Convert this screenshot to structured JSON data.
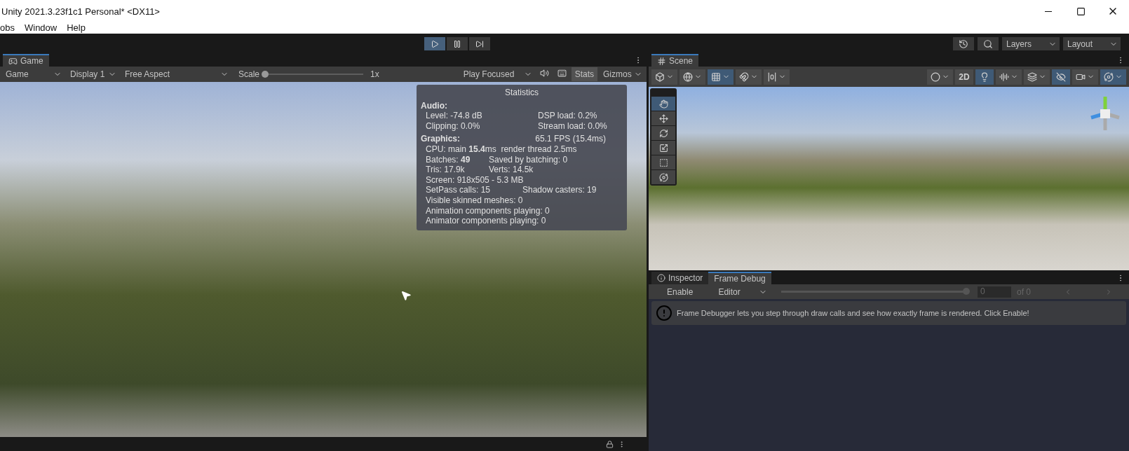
{
  "window": {
    "title": "Unity 2021.3.23f1c1 Personal* <DX11>"
  },
  "menu": [
    "obs",
    "Window",
    "Help"
  ],
  "play_controls": [
    {
      "kind": "play",
      "selected": true
    },
    {
      "kind": "pause",
      "selected": false
    },
    {
      "kind": "step",
      "selected": false
    }
  ],
  "main_toolbar": {
    "layers": "Layers",
    "layout": "Layout"
  },
  "game": {
    "tab": "Game",
    "toolbar": {
      "view": "Game",
      "display": "Display 1",
      "aspect": "Free Aspect",
      "scale_label": "Scale",
      "scale": {
        "level": 0
      },
      "scale_value": "1x",
      "play_mode": "Play Focused",
      "stats": {
        "label": "Stats",
        "selected": true
      },
      "gizmos": "Gizmos"
    },
    "statistics": {
      "title": "Statistics",
      "sections": [
        {
          "heading": "Audio:",
          "rows": [
            {
              "kind": "wide",
              "cells": [
                "Level: -74.8 dB",
                "DSP load: 0.2%"
              ]
            },
            {
              "kind": "wide",
              "cells": [
                "Clipping: 0.0%",
                "Stream load: 0.0%"
              ]
            }
          ]
        },
        {
          "heading": "Graphics:",
          "aside": "65.1 FPS (15.4ms)",
          "rows": [
            {
              "kind": "single",
              "cells": [
                "CPU: main **15.4**ms  render thread 2.5ms"
              ]
            },
            {
              "kind": "narrow",
              "cells": [
                "Batches: **49**",
                "Saved by batching: 0"
              ]
            },
            {
              "kind": "narrow",
              "cells": [
                "Tris: 17.9k",
                "Verts: 14.5k"
              ]
            },
            {
              "kind": "single",
              "cells": [
                "Screen: 918x505 - 5.3 MB"
              ]
            },
            {
              "kind": "medium",
              "cells": [
                "SetPass calls: 15",
                "Shadow casters: 19"
              ]
            },
            {
              "kind": "single",
              "cells": [
                "Visible skinned meshes: 0"
              ]
            },
            {
              "kind": "single",
              "cells": [
                "Animation components playing: 0"
              ]
            },
            {
              "kind": "single",
              "cells": [
                "Animator components playing: 0"
              ]
            }
          ]
        }
      ]
    }
  },
  "scene": {
    "tab": "Scene",
    "toolbar": [
      {
        "kind": "icon",
        "selected": false
      },
      {
        "kind": "icon",
        "selected": false
      },
      {
        "kind": "icon",
        "selected": true
      },
      {
        "kind": "icon",
        "selected": false
      },
      {
        "kind": "icon",
        "selected": false
      },
      {
        "kind": "icon",
        "selected": false
      },
      {
        "kind": "text",
        "label": "2D",
        "selected": false
      },
      {
        "kind": "icon",
        "selected": true
      },
      {
        "kind": "icon",
        "selected": false
      },
      {
        "kind": "icon",
        "selected": false
      },
      {
        "kind": "icon",
        "selected": true
      },
      {
        "kind": "icon",
        "selected": false
      },
      {
        "kind": "icon",
        "selected": true
      }
    ],
    "tools": [
      {
        "selected": true
      },
      {
        "selected": false
      },
      {
        "selected": false
      },
      {
        "selected": false
      },
      {
        "selected": false
      },
      {
        "selected": false
      }
    ]
  },
  "inspector": {
    "tabs": [
      {
        "label": "Inspector",
        "selected": false
      },
      {
        "label": "Frame Debug",
        "selected": true
      }
    ],
    "enable": "Enable",
    "mode": "Editor",
    "event": {
      "level": 1
    },
    "event_value": "0",
    "event_total": "of 0",
    "message": "Frame Debugger lets you step through draw calls and see how exactly frame is rendered. Click Enable!"
  }
}
